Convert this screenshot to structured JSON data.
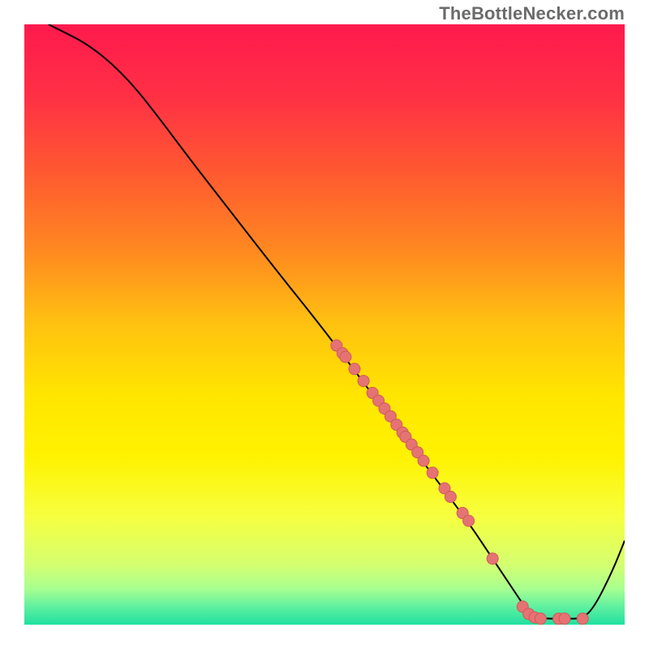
{
  "watermark": "TheBottleNecker.com",
  "colors": {
    "curve": "#000000",
    "dot_fill": "#e57373",
    "dot_stroke": "#d05a5a",
    "gradient_stops": [
      {
        "offset": 0.0,
        "color": "#ff1a4d"
      },
      {
        "offset": 0.12,
        "color": "#ff3045"
      },
      {
        "offset": 0.25,
        "color": "#ff5a30"
      },
      {
        "offset": 0.38,
        "color": "#ff8a20"
      },
      {
        "offset": 0.5,
        "color": "#ffc210"
      },
      {
        "offset": 0.62,
        "color": "#ffe600"
      },
      {
        "offset": 0.72,
        "color": "#fff200"
      },
      {
        "offset": 0.82,
        "color": "#f6ff40"
      },
      {
        "offset": 0.9,
        "color": "#d4ff70"
      },
      {
        "offset": 0.94,
        "color": "#a8ff90"
      },
      {
        "offset": 0.97,
        "color": "#60f0a0"
      },
      {
        "offset": 1.0,
        "color": "#20e0a0"
      }
    ]
  },
  "chart_data": {
    "type": "line",
    "title": "",
    "xlabel": "",
    "ylabel": "",
    "xlim": [
      0,
      100
    ],
    "ylim": [
      0,
      100
    ],
    "curve": [
      {
        "x": 4,
        "y": 100
      },
      {
        "x": 6,
        "y": 99
      },
      {
        "x": 10,
        "y": 97
      },
      {
        "x": 14,
        "y": 94
      },
      {
        "x": 18,
        "y": 90
      },
      {
        "x": 22,
        "y": 85
      },
      {
        "x": 28,
        "y": 77
      },
      {
        "x": 35,
        "y": 68
      },
      {
        "x": 42,
        "y": 59
      },
      {
        "x": 50,
        "y": 49
      },
      {
        "x": 56,
        "y": 41
      },
      {
        "x": 62,
        "y": 33
      },
      {
        "x": 68,
        "y": 25
      },
      {
        "x": 74,
        "y": 17
      },
      {
        "x": 78,
        "y": 11
      },
      {
        "x": 82,
        "y": 5
      },
      {
        "x": 84,
        "y": 2
      },
      {
        "x": 86,
        "y": 1
      },
      {
        "x": 90,
        "y": 1
      },
      {
        "x": 93,
        "y": 1
      },
      {
        "x": 95,
        "y": 3
      },
      {
        "x": 98,
        "y": 9
      },
      {
        "x": 100,
        "y": 14
      }
    ],
    "dots": [
      {
        "x": 52,
        "y": 46.5
      },
      {
        "x": 53,
        "y": 45.2
      },
      {
        "x": 53.5,
        "y": 44.6
      },
      {
        "x": 55,
        "y": 42.6
      },
      {
        "x": 56.5,
        "y": 40.6
      },
      {
        "x": 58,
        "y": 38.6
      },
      {
        "x": 59,
        "y": 37.3
      },
      {
        "x": 60,
        "y": 36.0
      },
      {
        "x": 61,
        "y": 34.7
      },
      {
        "x": 62,
        "y": 33.3
      },
      {
        "x": 63,
        "y": 32.0
      },
      {
        "x": 63.5,
        "y": 31.3
      },
      {
        "x": 64.5,
        "y": 30.0
      },
      {
        "x": 65.5,
        "y": 28.7
      },
      {
        "x": 66.5,
        "y": 27.3
      },
      {
        "x": 68,
        "y": 25.3
      },
      {
        "x": 70,
        "y": 22.7
      },
      {
        "x": 71,
        "y": 21.3
      },
      {
        "x": 73,
        "y": 18.6
      },
      {
        "x": 74,
        "y": 17.3
      },
      {
        "x": 78,
        "y": 11.0
      },
      {
        "x": 83,
        "y": 3.0
      },
      {
        "x": 84,
        "y": 1.8
      },
      {
        "x": 85,
        "y": 1.2
      },
      {
        "x": 86,
        "y": 1.0
      },
      {
        "x": 89,
        "y": 1.0
      },
      {
        "x": 90,
        "y": 1.0
      },
      {
        "x": 93,
        "y": 1.0
      }
    ]
  }
}
